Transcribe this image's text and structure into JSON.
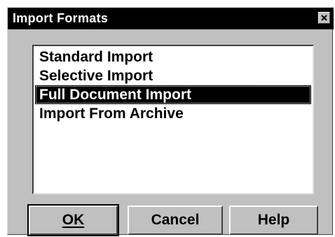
{
  "window": {
    "title": "Import Formats",
    "close_icon": "close-x-icon"
  },
  "list": {
    "items": [
      {
        "label": "Standard Import",
        "selected": false
      },
      {
        "label": "Selective Import",
        "selected": false
      },
      {
        "label": "Full Document Import",
        "selected": true
      },
      {
        "label": "Import From Archive",
        "selected": false
      }
    ]
  },
  "buttons": {
    "ok_label": "OK",
    "cancel_label": "Cancel",
    "help_label": "Help"
  },
  "colors": {
    "titlebar": "#000000",
    "selection": "#000000",
    "face": "#c0c0c0"
  }
}
